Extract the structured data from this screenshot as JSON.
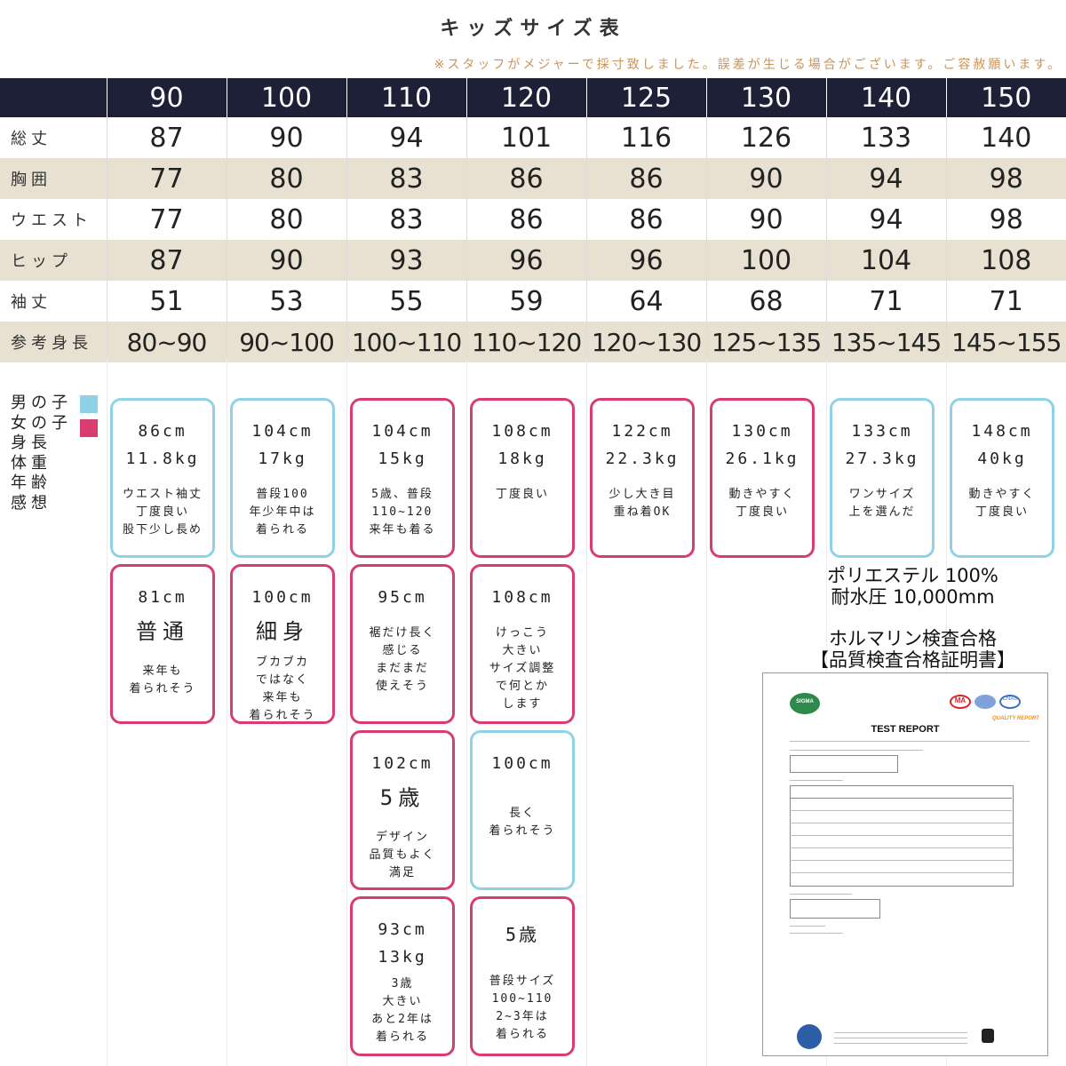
{
  "title": "キッズサイズ表",
  "note": "※スタッフがメジャーで採寸致しました。誤差が生じる場合がございます。ご容赦願います。",
  "colors": {
    "header_bg": "#1e2038",
    "alt_row": "#e8e1d1",
    "boy": "#8fd2e5",
    "girl": "#d83c70",
    "note": "#c9945a"
  },
  "table": {
    "sizes": [
      "90",
      "100",
      "110",
      "120",
      "125",
      "130",
      "140",
      "150"
    ],
    "rows": [
      {
        "label": "総丈",
        "values": [
          "87",
          "90",
          "94",
          "101",
          "116",
          "126",
          "133",
          "140"
        ]
      },
      {
        "label": "胸囲",
        "values": [
          "77",
          "80",
          "83",
          "86",
          "86",
          "90",
          "94",
          "98"
        ]
      },
      {
        "label": "ウエスト",
        "values": [
          "77",
          "80",
          "83",
          "86",
          "86",
          "90",
          "94",
          "98"
        ]
      },
      {
        "label": "ヒップ",
        "values": [
          "87",
          "90",
          "93",
          "96",
          "96",
          "100",
          "104",
          "108"
        ]
      },
      {
        "label": "袖丈",
        "values": [
          "51",
          "53",
          "55",
          "59",
          "64",
          "68",
          "71",
          "71"
        ]
      },
      {
        "label": "参考身長",
        "values": [
          "80~90",
          "90~100",
          "100~110",
          "110~120",
          "120~130",
          "125~135",
          "135~145",
          "145~155"
        ]
      }
    ]
  },
  "legend": {
    "boy": "男の子",
    "girl": "女の子",
    "height": "身長",
    "weight": "体重",
    "age": "年齢",
    "impression": "感想"
  },
  "cards": [
    {
      "gender": "boy",
      "l1": "86cm",
      "l2": "11.8kg",
      "comment": "ウエスト袖丈\n丁度良い\n股下少し長め"
    },
    {
      "gender": "boy",
      "l1": "104cm",
      "l2": "17kg",
      "comment": "普段100\n年少年中は\n着られる"
    },
    {
      "gender": "girl",
      "l1": "104cm",
      "l2": "15kg",
      "comment": "5歳、普段\n110~120\n来年も着る"
    },
    {
      "gender": "girl",
      "l1": "108cm",
      "l2": "18kg",
      "comment": "丁度良い"
    },
    {
      "gender": "girl",
      "l1": "122cm",
      "l2": "22.3kg",
      "comment": "少し大き目\n重ね着OK"
    },
    {
      "gender": "girl",
      "l1": "130cm",
      "l2": "26.1kg",
      "comment": "動きやすく\n丁度良い"
    },
    {
      "gender": "boy",
      "l1": "133cm",
      "l2": "27.3kg",
      "comment": "ワンサイズ\n上を選んだ"
    },
    {
      "gender": "boy",
      "l1": "148cm",
      "l2": "40kg",
      "comment": "動きやすく\n丁度良い"
    },
    {
      "gender": "girl",
      "l1": "81cm",
      "l2": "普通",
      "comment": "来年も\n着られそう"
    },
    {
      "gender": "girl",
      "l1": "100cm",
      "l2": "細身",
      "comment": "ブカブカ\nではなく\n来年も\n着られそう"
    },
    {
      "gender": "girl",
      "l1": "95cm",
      "l2": "",
      "comment": "裾だけ長く\n感じる\nまだまだ\n使えそう"
    },
    {
      "gender": "girl",
      "l1": "108cm",
      "l2": "",
      "comment": "けっこう\n大きい\nサイズ調整\nで何とか\nします"
    },
    {
      "gender": "girl",
      "l1": "102cm",
      "l2": "5歳",
      "comment": "デザイン\n品質もよく\n満足"
    },
    {
      "gender": "boy",
      "l1": "100cm",
      "l2": "",
      "comment": "長く\n着られそう"
    },
    {
      "gender": "girl",
      "l1": "93cm",
      "l2": "13kg",
      "comment": "3歳\n大きい\nあと2年は\n着られる"
    },
    {
      "gender": "girl",
      "l1": "5歳",
      "l2": "",
      "comment": "普段サイズ\n100~110\n2~3年は\n着られる"
    }
  ],
  "material": {
    "line1": "ポリエステル 100%",
    "line2": "耐水圧 10,000mm"
  },
  "cert": {
    "line1": "ホルマリン検査合格",
    "line2": "【品質検査合格証明書】"
  },
  "report": {
    "title": "TEST REPORT",
    "logo_text": "SIGMA",
    "quality": "QUALITY REPORT",
    "badge_ma": "MA",
    "badge_cnas": "CNAS"
  }
}
